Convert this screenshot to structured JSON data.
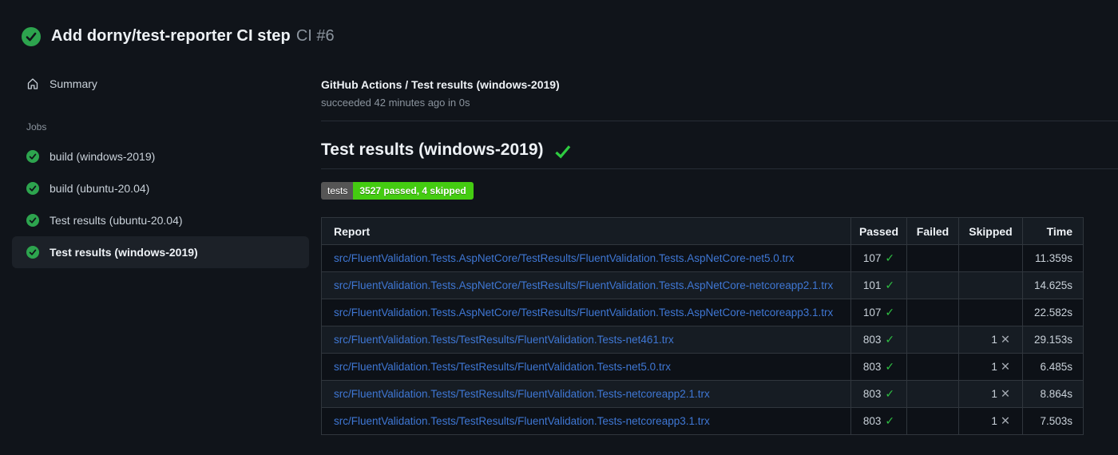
{
  "header": {
    "title": "Add dorny/test-reporter CI step",
    "run_number": "CI #6",
    "status": "success"
  },
  "sidebar": {
    "summary_label": "Summary",
    "jobs_heading": "Jobs",
    "jobs": [
      {
        "label": "build (windows-2019)",
        "status": "success",
        "selected": false
      },
      {
        "label": "build (ubuntu-20.04)",
        "status": "success",
        "selected": false
      },
      {
        "label": "Test results (ubuntu-20.04)",
        "status": "success",
        "selected": false
      },
      {
        "label": "Test results (windows-2019)",
        "status": "success",
        "selected": true
      }
    ]
  },
  "main": {
    "check_title": "GitHub Actions / Test results (windows-2019)",
    "check_status": "succeeded 42 minutes ago in 0s",
    "section_title": "Test results (windows-2019)",
    "badge": {
      "label": "tests",
      "message": "3527 passed, 4 skipped",
      "label_bg": "#555555",
      "message_bg": "#44cc11"
    },
    "table": {
      "headers": [
        "Report",
        "Passed",
        "Failed",
        "Skipped",
        "Time"
      ],
      "rows": [
        {
          "report": "src/FluentValidation.Tests.AspNetCore/TestResults/FluentValidation.Tests.AspNetCore-net5.0.trx",
          "passed": "107",
          "failed": "",
          "skipped": "",
          "time": "11.359s"
        },
        {
          "report": "src/FluentValidation.Tests.AspNetCore/TestResults/FluentValidation.Tests.AspNetCore-netcoreapp2.1.trx",
          "passed": "101",
          "failed": "",
          "skipped": "",
          "time": "14.625s"
        },
        {
          "report": "src/FluentValidation.Tests.AspNetCore/TestResults/FluentValidation.Tests.AspNetCore-netcoreapp3.1.trx",
          "passed": "107",
          "failed": "",
          "skipped": "",
          "time": "22.582s"
        },
        {
          "report": "src/FluentValidation.Tests/TestResults/FluentValidation.Tests-net461.trx",
          "passed": "803",
          "failed": "",
          "skipped": "1",
          "time": "29.153s"
        },
        {
          "report": "src/FluentValidation.Tests/TestResults/FluentValidation.Tests-net5.0.trx",
          "passed": "803",
          "failed": "",
          "skipped": "1",
          "time": "6.485s"
        },
        {
          "report": "src/FluentValidation.Tests/TestResults/FluentValidation.Tests-netcoreapp2.1.trx",
          "passed": "803",
          "failed": "",
          "skipped": "1",
          "time": "8.864s"
        },
        {
          "report": "src/FluentValidation.Tests/TestResults/FluentValidation.Tests-netcoreapp3.1.trx",
          "passed": "803",
          "failed": "",
          "skipped": "1",
          "time": "7.503s"
        }
      ]
    }
  },
  "glyphs": {
    "passed_check": "✓",
    "skipped_cross": "✕"
  },
  "icons": {
    "header_status": "check-circle-icon",
    "summary": "home-icon",
    "job_status": "check-circle-icon",
    "section_status": "check-icon"
  },
  "colors": {
    "status_green": "#2da44e",
    "check_green": "#2fc043",
    "link_blue": "#3f77d4",
    "cross_gray": "#a3a9b1",
    "selected_item_bg": "#1c2128"
  }
}
